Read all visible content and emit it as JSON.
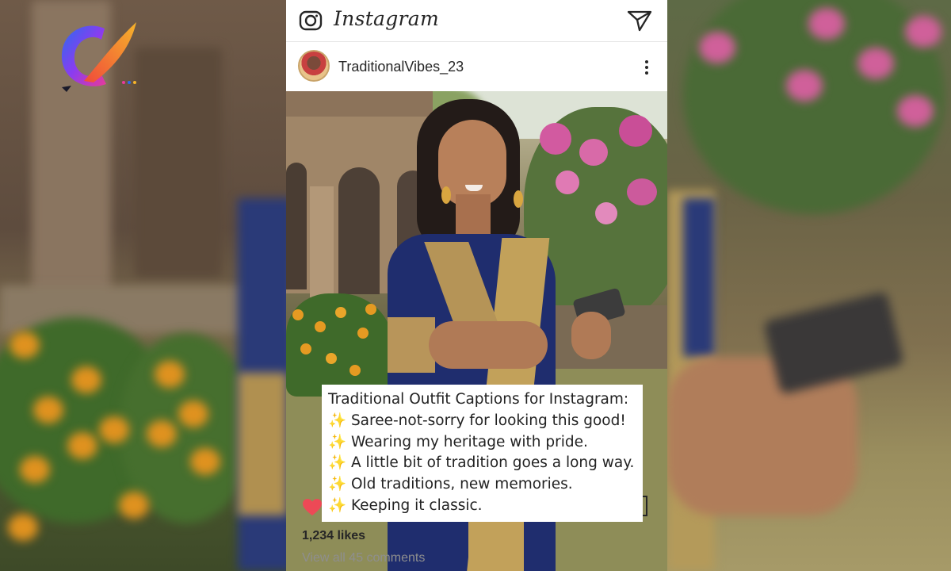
{
  "app": {
    "brand_name": "Instagram",
    "icons": {
      "camera": "camera-icon",
      "send": "send-icon",
      "more": "more-vertical-icon",
      "heart": "heart-icon"
    }
  },
  "post": {
    "username": "TraditionalVibes_23",
    "likes": "1,234 likes",
    "view_comments": "View all 45 comments"
  },
  "caption": {
    "title": "Traditional Outfit Captions for Instagram:",
    "lines": [
      {
        "emoji": "✨",
        "text": "Saree-not-sorry for looking this good!"
      },
      {
        "emoji": "✨",
        "text": "Wearing my heritage with pride."
      },
      {
        "emoji": "✨",
        "text": "A little bit of tradition goes a long way."
      },
      {
        "emoji": "✨",
        "text": "Old traditions, new memories."
      },
      {
        "emoji": "✨",
        "text": "Keeping it classic."
      }
    ]
  },
  "colors": {
    "text": "#262626",
    "muted": "#8e8e8e",
    "heart": "#ed4956",
    "sparkle": "#f3b728",
    "saree_blue": "#1f2d6e",
    "saree_gold": "#c2a15a"
  }
}
